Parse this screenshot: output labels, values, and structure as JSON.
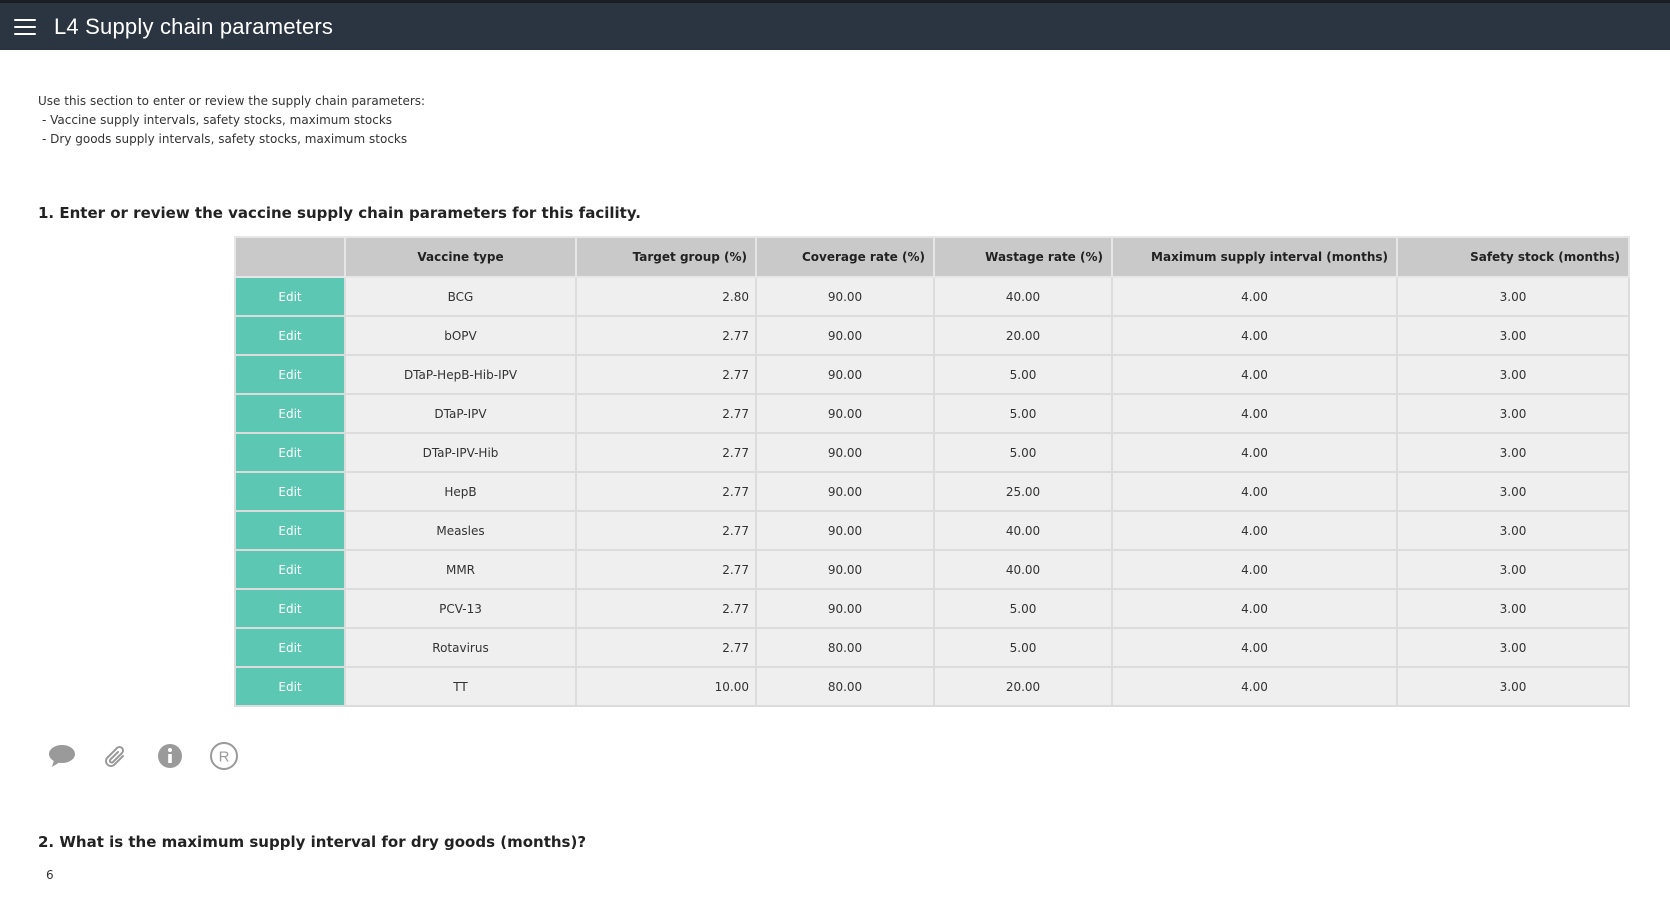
{
  "window": {
    "title": "L4 Supply chain parameters"
  },
  "intro": {
    "line1": "Use this section to enter or review the supply chain parameters:",
    "line2": "- Vaccine supply intervals, safety stocks, maximum stocks",
    "line3": "- Dry goods supply intervals, safety stocks, maximum stocks"
  },
  "question1": "1. Enter or review the vaccine supply chain parameters for this facility.",
  "table": {
    "headers": [
      "",
      "Vaccine type",
      "Target group (%)",
      "Coverage rate (%)",
      "Wastage rate (%)",
      "Maximum supply interval (months)",
      "Safety stock (months)"
    ],
    "edit_label": "Edit",
    "rows": [
      [
        "BCG",
        "2.80",
        "90.00",
        "40.00",
        "4.00",
        "3.00"
      ],
      [
        "bOPV",
        "2.77",
        "90.00",
        "20.00",
        "4.00",
        "3.00"
      ],
      [
        "DTaP-HepB-Hib-IPV",
        "2.77",
        "90.00",
        "5.00",
        "4.00",
        "3.00"
      ],
      [
        "DTaP-IPV",
        "2.77",
        "90.00",
        "5.00",
        "4.00",
        "3.00"
      ],
      [
        "DTaP-IPV-Hib",
        "2.77",
        "90.00",
        "5.00",
        "4.00",
        "3.00"
      ],
      [
        "HepB",
        "2.77",
        "90.00",
        "25.00",
        "4.00",
        "3.00"
      ],
      [
        "Measles",
        "2.77",
        "90.00",
        "40.00",
        "4.00",
        "3.00"
      ],
      [
        "MMR",
        "2.77",
        "90.00",
        "40.00",
        "4.00",
        "3.00"
      ],
      [
        "PCV-13",
        "2.77",
        "90.00",
        "5.00",
        "4.00",
        "3.00"
      ],
      [
        "Rotavirus",
        "2.77",
        "80.00",
        "5.00",
        "4.00",
        "3.00"
      ],
      [
        "TT",
        "10.00",
        "80.00",
        "20.00",
        "4.00",
        "3.00"
      ]
    ]
  },
  "icons": [
    "comment-icon",
    "attachment-icon",
    "info-icon",
    "registered-icon"
  ],
  "question2": "2. What is the maximum supply interval for dry goods (months)?",
  "answer2": "6",
  "colors": {
    "titlebar": "#2b3441",
    "edit_button": "#5cc7b2",
    "header_bg": "#c9c9c9",
    "cell_bg": "#efefef"
  }
}
